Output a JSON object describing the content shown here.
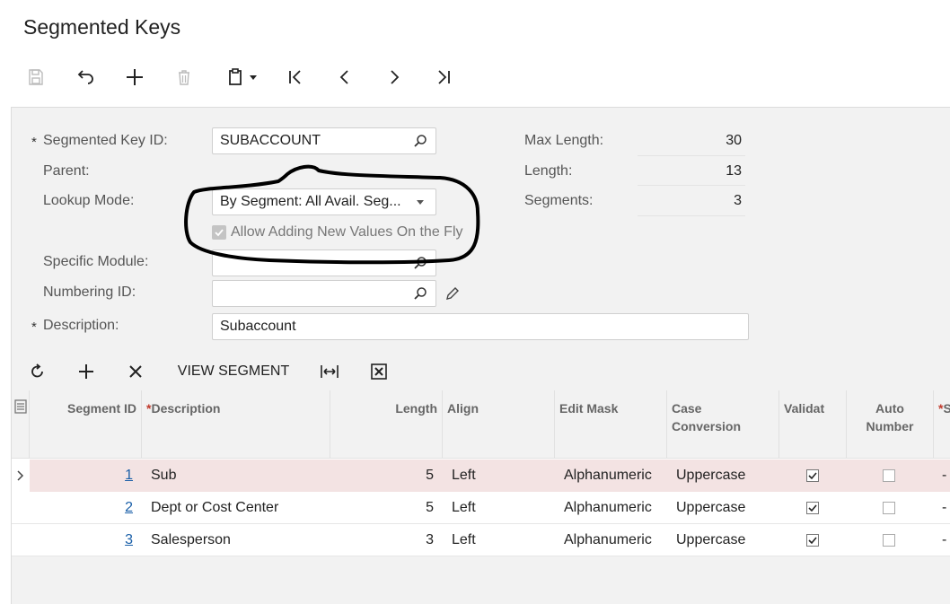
{
  "page": {
    "title": "Segmented Keys"
  },
  "toolbar": {
    "icons": [
      "save-icon",
      "undo-icon",
      "add-icon",
      "delete-icon",
      "clipboard-icon",
      "first-icon",
      "prev-icon",
      "next-icon",
      "last-icon"
    ]
  },
  "form": {
    "segmented_key_id": {
      "label": "Segmented Key ID:",
      "value": "SUBACCOUNT",
      "required_mark": "*"
    },
    "parent": {
      "label": "Parent:"
    },
    "lookup_mode": {
      "label": "Lookup Mode:",
      "value": "By Segment: All Avail. Seg..."
    },
    "allow_adding": {
      "label": "Allow Adding New Values On the Fly",
      "checked": true
    },
    "specific_module": {
      "label": "Specific Module:",
      "value": ""
    },
    "numbering_id": {
      "label": "Numbering ID:",
      "value": ""
    },
    "description": {
      "label": "Description:",
      "value": "Subaccount",
      "required_mark": "*"
    },
    "max_length": {
      "label": "Max Length:",
      "value": "30"
    },
    "length": {
      "label": "Length:",
      "value": "13"
    },
    "segments": {
      "label": "Segments:",
      "value": "3"
    }
  },
  "grid_toolbar": {
    "view_segment_label": "VIEW SEGMENT"
  },
  "grid": {
    "columns": [
      {
        "label": "Segment ID",
        "required": false
      },
      {
        "label": "Description",
        "required": true
      },
      {
        "label": "Length",
        "required": false
      },
      {
        "label": "Align",
        "required": false
      },
      {
        "label": "Edit Mask",
        "required": false
      },
      {
        "label": "Case Conversion",
        "required": false
      },
      {
        "label": "Validat",
        "required": false
      },
      {
        "label": "Auto Number",
        "required": false
      },
      {
        "label": "S",
        "required": true
      }
    ],
    "rows": [
      {
        "segment_id": "1",
        "description": "Sub",
        "length": "5",
        "align": "Left",
        "edit_mask": "Alphanumeric",
        "case_conversion": "Uppercase",
        "validate": true,
        "auto_number": false,
        "extra": "-"
      },
      {
        "segment_id": "2",
        "description": "Dept or Cost Center",
        "length": "5",
        "align": "Left",
        "edit_mask": "Alphanumeric",
        "case_conversion": "Uppercase",
        "validate": true,
        "auto_number": false,
        "extra": "-"
      },
      {
        "segment_id": "3",
        "description": "Salesperson",
        "length": "3",
        "align": "Left",
        "edit_mask": "Alphanumeric",
        "case_conversion": "Uppercase",
        "validate": true,
        "auto_number": false,
        "extra": "-"
      }
    ]
  },
  "colors": {
    "selected_row": "#f3e3e3",
    "link": "#1a5fa8",
    "required": "#c0392b",
    "annotation": "#000000"
  }
}
